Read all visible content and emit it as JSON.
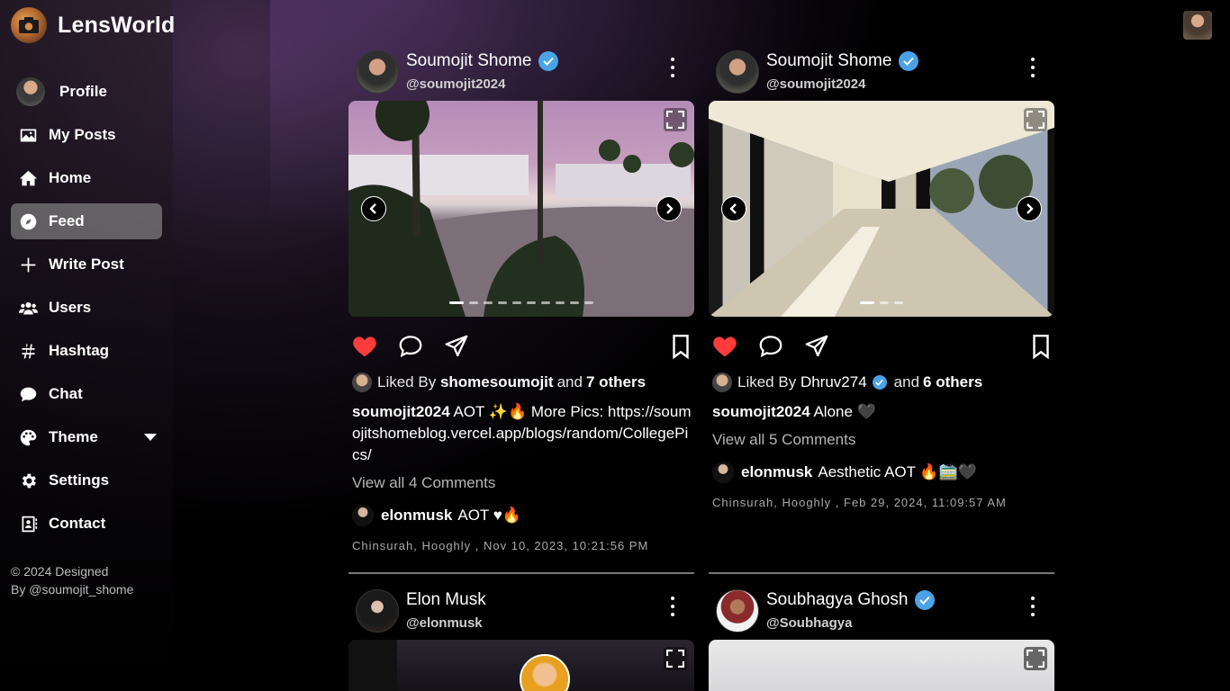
{
  "app": {
    "name": "LensWorld"
  },
  "sidebar": {
    "items": [
      {
        "label": "Profile",
        "icon": "profile-avatar"
      },
      {
        "label": "My Posts",
        "icon": "image-icon"
      },
      {
        "label": "Home",
        "icon": "home-icon"
      },
      {
        "label": "Feed",
        "icon": "compass-icon",
        "active": true
      },
      {
        "label": "Write Post",
        "icon": "plus-icon"
      },
      {
        "label": "Users",
        "icon": "users-icon"
      },
      {
        "label": "Hashtag",
        "icon": "hashtag-icon"
      },
      {
        "label": "Chat",
        "icon": "chat-icon"
      },
      {
        "label": "Theme",
        "icon": "palette-icon"
      },
      {
        "label": "Settings",
        "icon": "gear-icon"
      },
      {
        "label": "Contact",
        "icon": "contact-card-icon"
      }
    ],
    "copyright_line1": "© 2024 Designed",
    "copyright_line2": "By @soumojit_shome"
  },
  "posts": [
    {
      "name": "Soumojit Shome",
      "handle": "@soumojit2024",
      "verified": true,
      "liked_prefix": "Liked By",
      "liked_user": "shomesoumojit",
      "liked_and": "and",
      "liked_others": "7 others",
      "caption_user": "soumojit2024",
      "caption_text": "AOT ✨🔥 More Pics: https://soumojitshomeblog.vercel.app/blogs/random/CollegePics/",
      "view_all": "View all 4 Comments",
      "comment_user": "elonmusk",
      "comment_text": "AOT ♥🔥",
      "meta": "Chinsurah, Hooghly , Nov 10, 2023, 10:21:56 PM"
    },
    {
      "name": "Soumojit Shome",
      "handle": "@soumojit2024",
      "verified": true,
      "liked_prefix": "Liked By",
      "liked_user": "Dhruv274",
      "liked_and": "and",
      "liked_others": "6 others",
      "caption_user": "soumojit2024",
      "caption_text": "Alone 🖤",
      "view_all": "View all 5 Comments",
      "comment_user": "elonmusk",
      "comment_text": "Aesthetic AOT 🔥🚞🖤",
      "meta": "Chinsurah, Hooghly , Feb 29, 2024, 11:09:57 AM"
    },
    {
      "name": "Elon Musk",
      "handle": "@elonmusk",
      "verified": false
    },
    {
      "name": "Soubhagya Ghosh",
      "handle": "@Soubhagya",
      "verified": true
    }
  ],
  "colors": {
    "like": "#ff3b3b",
    "verified": "#4aa3e6",
    "active_nav": "#9a9a9a"
  }
}
